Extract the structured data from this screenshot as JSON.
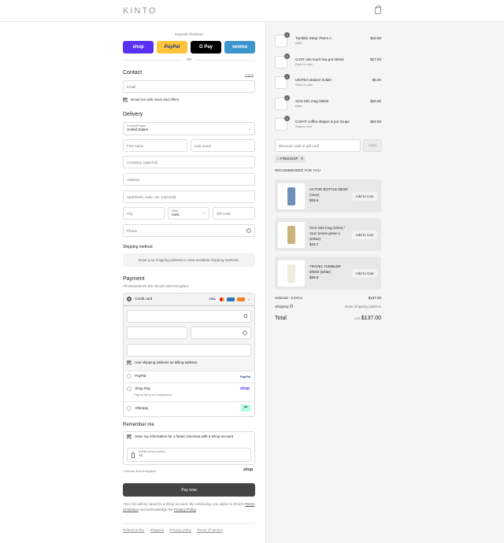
{
  "header": {
    "logo": "KINTO"
  },
  "express": {
    "title": "Express checkout",
    "buttons": [
      {
        "label": "shop",
        "bg": "#5a31f4",
        "color": "#fff"
      },
      {
        "label": "PayPal",
        "bg": "#ffc439",
        "color": "#1f3c8b"
      },
      {
        "label": "G Pay",
        "bg": "#000000",
        "color": "#fff"
      },
      {
        "label": "venmo",
        "bg": "#3d95ce",
        "color": "#fff"
      }
    ],
    "or": "OR"
  },
  "contact": {
    "title": "Contact",
    "login": "Log in",
    "email_placeholder": "Email",
    "news_label": "Email me with news and offers"
  },
  "delivery": {
    "title": "Delivery",
    "country_label": "Country/Region",
    "country_value": "United States",
    "first_name": "First name",
    "last_name": "Last name",
    "company": "Company (optional)",
    "address": "Address",
    "apartment": "Apartment, suite, etc. (optional)",
    "city": "City",
    "state_label": "State",
    "state_value": "Iowa",
    "zip": "ZIP code",
    "phone": "Phone"
  },
  "shipping": {
    "title": "Shipping method",
    "note": "Enter your shipping address to view available shipping methods."
  },
  "payment": {
    "title": "Payment",
    "subtitle": "All transactions are secure and encrypted.",
    "credit_card": "Credit card",
    "card_more": "+",
    "billing_label": "Use shipping address as billing address",
    "paypal": "PayPal",
    "paypal_logo": "PayPal",
    "shop_pay": "Shop Pay",
    "shop_pay_sub": "Pay in full or in installments",
    "shop_logo": "shop",
    "afterpay": "Afterpay"
  },
  "remember": {
    "title": "Remember me",
    "save_label": "Save my information for a faster checkout with a Shop account",
    "mobile_label": "Mobile phone number",
    "mobile_value": "+1",
    "secure": "Secure and encrypted",
    "shop_logo": "shop"
  },
  "pay_now": "Pay now",
  "legal": {
    "text1": "Your info will be saved to a Shop account. By continuing, you agree to Shop's",
    "terms": "Terms of Service",
    "text2": "and acknowledge the",
    "privacy": "Privacy Policy",
    "end": "."
  },
  "footer": [
    "Refund policy",
    "Shipping",
    "Privacy policy",
    "Terms of service"
  ],
  "order": {
    "items": [
      {
        "name": "Tumbler Strap 75mm A",
        "variant": "white",
        "price": "$18.60",
        "qty": "1"
      },
      {
        "name": "CAST one touch tea pot 450ml",
        "variant": "Clear no color",
        "price": "$27.50",
        "qty": "1"
      },
      {
        "name": "UNITEA strainer holder",
        "variant": "Clear no color",
        "price": "$8.20",
        "qty": "1"
      },
      {
        "name": "SCS-S01 mug 330ml",
        "variant": "black",
        "price": "$20.00",
        "qty": "1"
      },
      {
        "name": "CARAT coffee dripper & pot 4cups",
        "variant": "Gray no color",
        "price": "$62.50",
        "qty": "1"
      }
    ],
    "discount_placeholder": "Discount code or gift card",
    "apply": "Apply",
    "code": "FREESHIP",
    "recommended_title": "RECOMMENDED FOR YOU",
    "recommended": [
      {
        "name": "ACTIVE BOTTLE 950ml (navy)",
        "price": "$26.6",
        "add": "Add to Cart"
      },
      {
        "name": "SCS-S03 mug 320ml / 11oz (moss green x yellow)",
        "price": "$23.7",
        "add": "Add to Cart"
      },
      {
        "name": "TRAVEL TUMBLER 500ml (white)",
        "price": "$36.8",
        "add": "Add to Cart"
      }
    ],
    "subtotal_label": "Subtotal · 5 items",
    "subtotal": "$137.00",
    "shipping_label": "Shipping",
    "shipping_value": "Enter shipping address",
    "total_label": "Total",
    "currency": "USD",
    "total": "$137.00"
  }
}
